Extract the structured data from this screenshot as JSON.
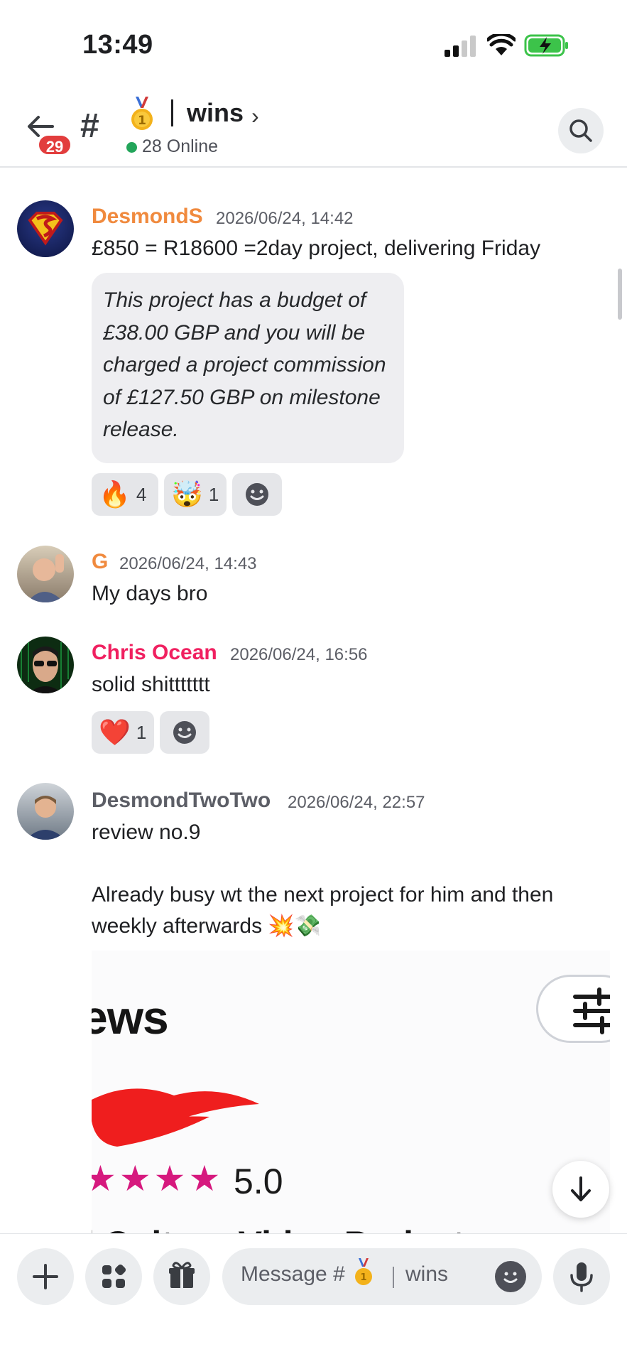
{
  "status_bar": {
    "time": "13:49"
  },
  "header": {
    "unread_count": "29",
    "channel_name": "wins",
    "online_text": "28 Online"
  },
  "messages": [
    {
      "author": "DesmondS",
      "author_color": "#f08a3e",
      "timestamp": "2026/06/24, 14:42",
      "text": "£850 = R18600 =2day project, delivering Friday",
      "quote": "This project has a budget of £38.00 GBP and you will be charged a project commission of £127.50 GBP on milestone release.",
      "reactions": [
        {
          "emoji": "🔥",
          "count": "4"
        },
        {
          "emoji": "🤯",
          "count": "1"
        }
      ]
    },
    {
      "author": "G",
      "author_color": "#f08a3e",
      "timestamp": "2026/06/24, 14:43",
      "text": "My days bro"
    },
    {
      "author": "Chris Ocean",
      "author_color": "#f02060",
      "timestamp": "2026/06/24, 16:56",
      "text": "solid shittttttt",
      "reactions": [
        {
          "emoji": "❤️",
          "count": "1"
        }
      ]
    },
    {
      "author": "DesmondTwoTwo",
      "author_color": "#5c5e66",
      "timestamp": "2026/06/24, 22:57",
      "text_line1": "review no.9",
      "text_line2": "Already busy wt the next project for him and then",
      "text_line3": "weekly afterwards 💥💸",
      "preview": {
        "title": "ews",
        "stars": "★★★★",
        "rating": "5.0",
        "bottom_text": "l Culture Video Project"
      }
    }
  ],
  "composer": {
    "placeholder_prefix": "Message #",
    "placeholder_channel": "wins"
  },
  "icons": {
    "back": "arrow-left-icon",
    "channel": "hash-icon",
    "medal": "medal-icon",
    "search": "search-icon",
    "plus": "plus-icon",
    "apps": "apps-icon",
    "gift": "gift-icon",
    "emoji": "emoji-icon",
    "mic": "microphone-icon",
    "scroll": "arrow-down-icon"
  }
}
